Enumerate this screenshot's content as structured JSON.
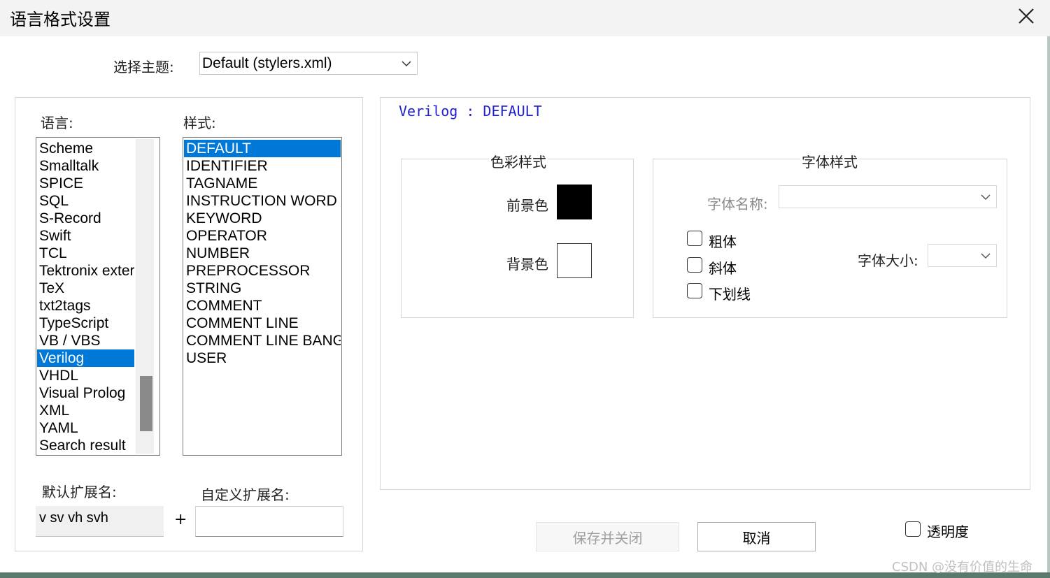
{
  "window": {
    "title": "语言格式设置"
  },
  "theme": {
    "label": "选择主题:",
    "selected": "Default (stylers.xml)"
  },
  "language": {
    "label": "语言:",
    "items": [
      "Scheme",
      "Smalltalk",
      "SPICE",
      "SQL",
      "S-Record",
      "Swift",
      "TCL",
      "Tektronix exter",
      "TeX",
      "txt2tags",
      "TypeScript",
      "VB / VBS",
      "Verilog",
      "VHDL",
      "Visual Prolog",
      "XML",
      "YAML",
      "Search result"
    ],
    "selected": "Verilog"
  },
  "style": {
    "label": "样式:",
    "items": [
      "DEFAULT",
      "IDENTIFIER",
      "TAGNAME",
      "INSTRUCTION WORD",
      "KEYWORD",
      "OPERATOR",
      "NUMBER",
      "PREPROCESSOR",
      "STRING",
      "COMMENT",
      "COMMENT LINE",
      "COMMENT LINE BANG",
      "USER"
    ],
    "selected": "DEFAULT"
  },
  "preview": {
    "text": "Verilog : DEFAULT"
  },
  "color_style": {
    "title": "色彩样式",
    "foreground_label": "前景色",
    "background_label": "背景色",
    "foreground_color": "#000000",
    "background_color": "#ffffff"
  },
  "font_style": {
    "title": "字体样式",
    "font_name_label": "字体名称:",
    "font_name_value": "",
    "font_size_label": "字体大小:",
    "font_size_value": "",
    "bold_label": "粗体",
    "italic_label": "斜体",
    "underline_label": "下划线",
    "bold": false,
    "italic": false,
    "underline": false
  },
  "extensions": {
    "default_label": "默认扩展名:",
    "default_value": "v sv vh svh",
    "plus": "+",
    "custom_label": "自定义扩展名:",
    "custom_value": ""
  },
  "buttons": {
    "save_close": "保存并关闭",
    "cancel": "取消"
  },
  "transparency": {
    "label": "透明度",
    "checked": false
  },
  "watermark": "CSDN @没有价值的生命",
  "colors": {
    "selection": "#0078d7",
    "preview_text": "#2020d0"
  }
}
